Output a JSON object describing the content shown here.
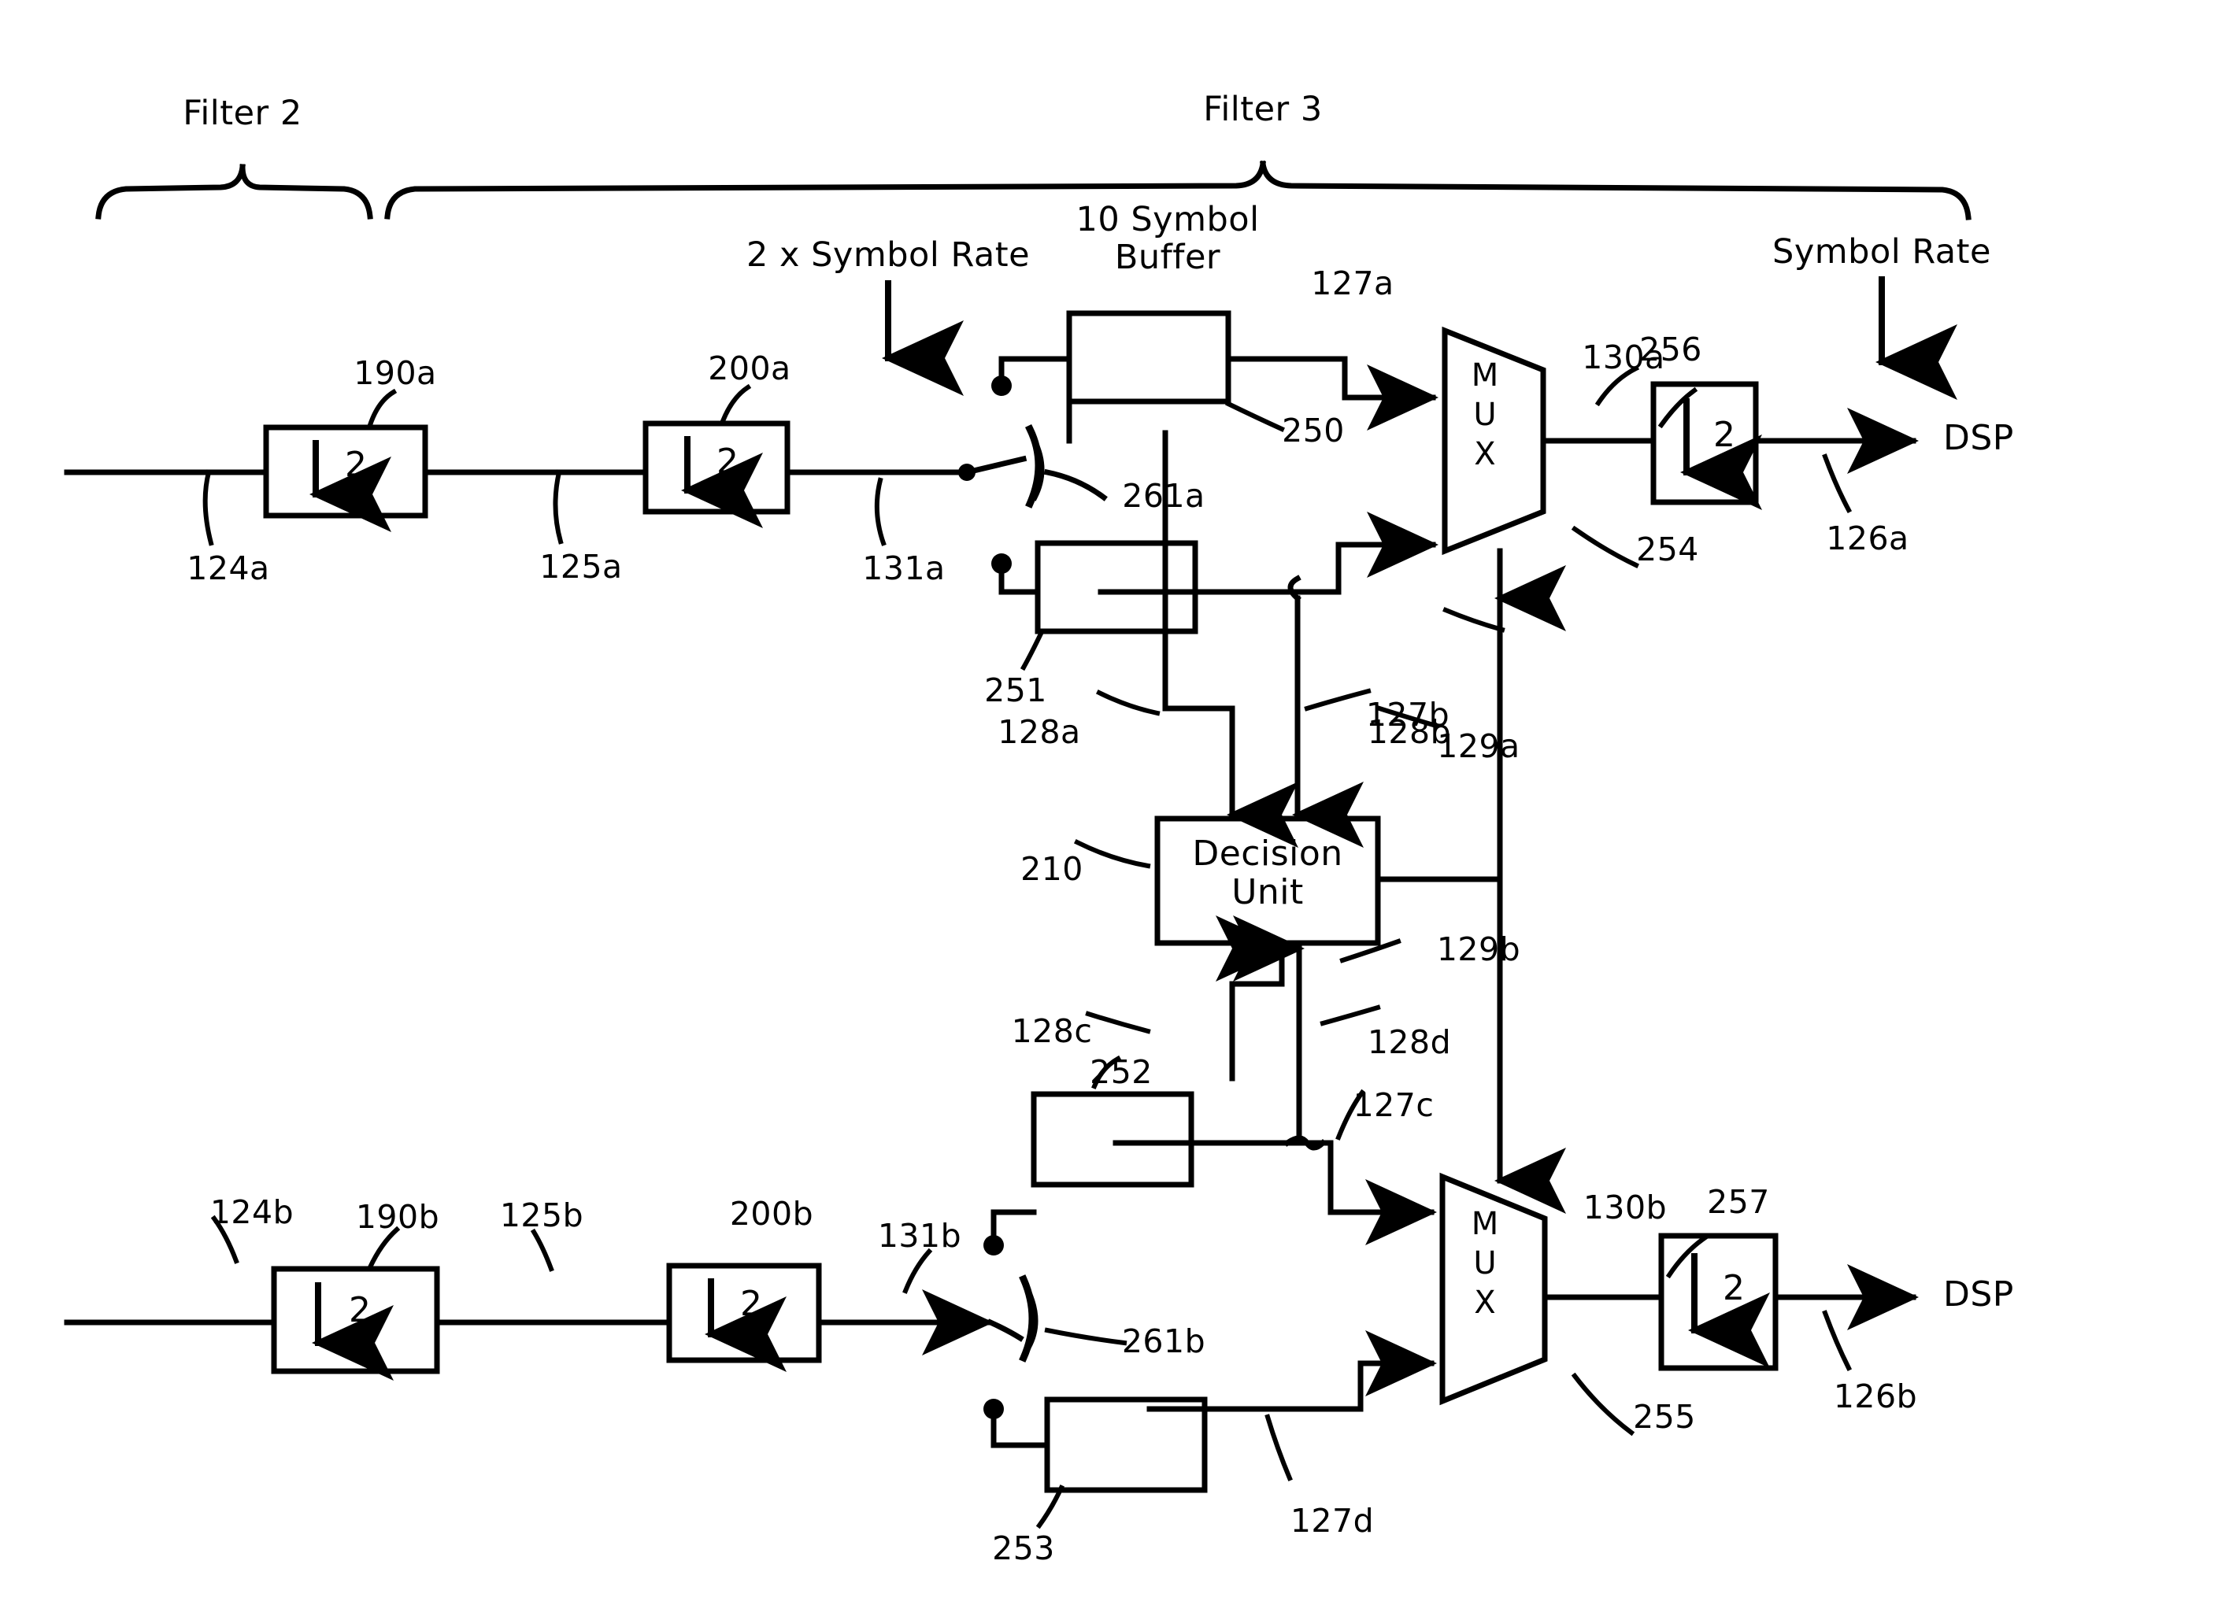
{
  "figure": {
    "type": "patent-block-diagram",
    "background": "#ffffff",
    "ink": "#000000"
  },
  "braces": {
    "filter2_label": "Filter 2",
    "filter3_label": "Filter 3"
  },
  "rate_annotations": {
    "two_x_symbol_rate": "2 x Symbol Rate",
    "symbol_buffer": "10 Symbol\nBuffer",
    "symbol_rate": "Symbol Rate"
  },
  "blocks": {
    "downsampler_190a": {
      "label": "2",
      "ref": "190a"
    },
    "downsampler_200a": {
      "label": "2",
      "ref": "200a"
    },
    "downsampler_190b": {
      "label": "2",
      "ref": "190b"
    },
    "downsampler_200b": {
      "label": "2",
      "ref": "200b"
    },
    "downsampler_256": {
      "label": "2",
      "ref": "256"
    },
    "downsampler_257": {
      "label": "2",
      "ref": "257"
    },
    "buffer_250": {
      "ref": "250"
    },
    "buffer_251": {
      "ref": "251"
    },
    "buffer_252": {
      "ref": "252"
    },
    "buffer_253": {
      "ref": "253"
    },
    "mux_254": {
      "label": "M\nU\nX",
      "ref": "254"
    },
    "mux_255": {
      "label": "M\nU\nX",
      "ref": "255"
    },
    "decision_unit": {
      "label": "Decision\nUnit",
      "ref": "210"
    }
  },
  "switches": {
    "switch_261a": "261a",
    "switch_261b": "261b"
  },
  "signal_refs": {
    "in_124a": "124a",
    "mid_125a": "125a",
    "mid_131a": "131a",
    "buf_out_127a": "127a",
    "buf_out_127b": "127b",
    "buf_out_127c": "127c",
    "buf_out_127d": "127d",
    "dec_in_128a": "128a",
    "dec_in_128b": "128b",
    "dec_in_128c": "128c",
    "dec_in_128d": "128d",
    "ctrl_129a": "129a",
    "ctrl_129b": "129b",
    "mux_out_130a": "130a",
    "mux_out_130b": "130b",
    "out_126a": "126a",
    "out_126b": "126b",
    "in_124b": "124b",
    "mid_125b": "125b",
    "mid_131b": "131b"
  },
  "outputs": {
    "dsp_top": "DSP",
    "dsp_bottom": "DSP"
  }
}
